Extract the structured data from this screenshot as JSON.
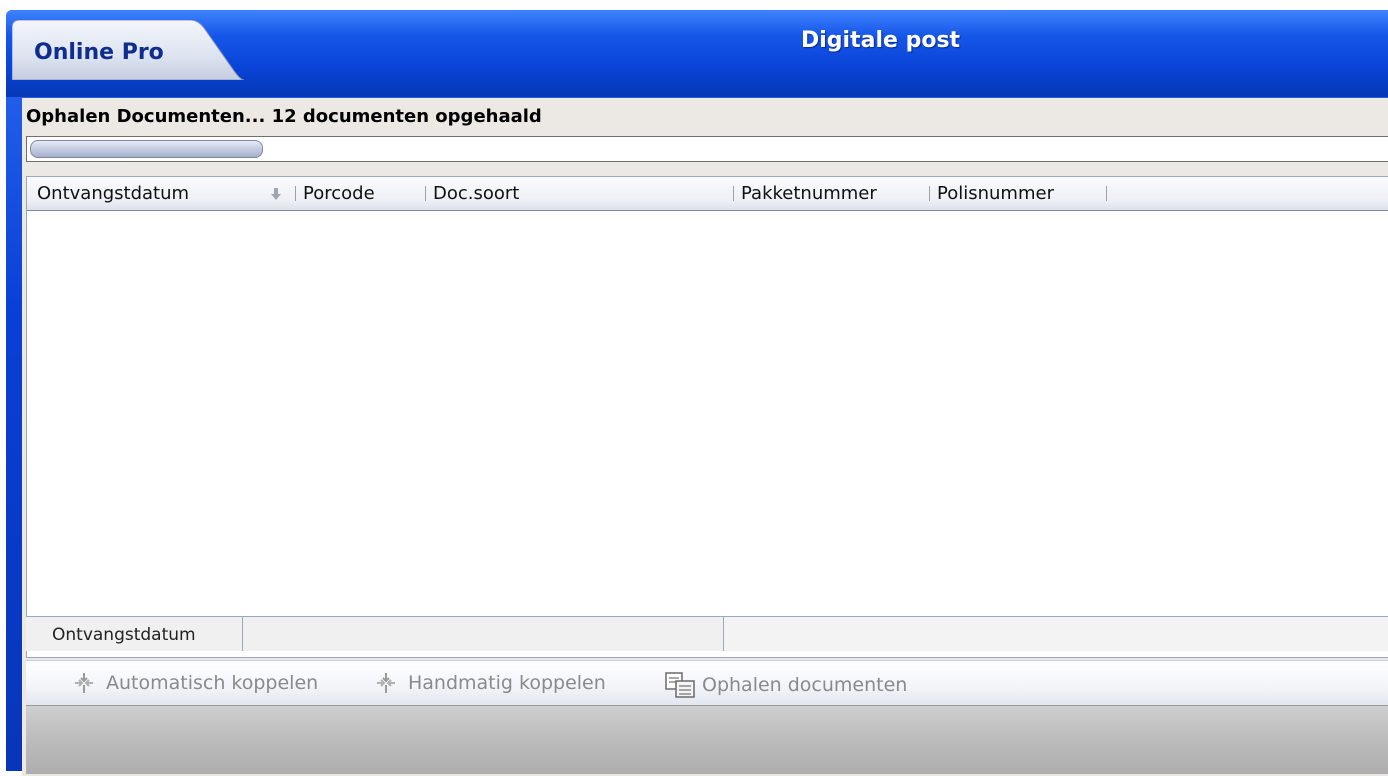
{
  "window": {
    "title": "Digitale post",
    "tab_label": "Online Pro"
  },
  "status": {
    "message": "Ophalen Documenten... 12 documenten opgehaald",
    "progress_fraction": 0.17
  },
  "grid": {
    "columns": [
      {
        "label": "Ontvangstdatum",
        "sorted": "descending"
      },
      {
        "label": "Porcode"
      },
      {
        "label": "Doc.soort"
      },
      {
        "label": "Pakketnummer"
      },
      {
        "label": "Polisnummer"
      }
    ],
    "rows": [],
    "footer": {
      "group_label": "Ontvangstdatum"
    }
  },
  "toolbar": {
    "auto_link_label": "Automatisch koppelen",
    "manual_link_label": "Handmatig koppelen",
    "fetch_docs_label": "Ophalen documenten"
  },
  "icons": {
    "sort": "arrow-down-icon",
    "auto_link": "link-arrows-icon",
    "manual_link": "link-arrows-icon",
    "fetch_docs": "documents-icon"
  },
  "colors": {
    "titlebar": "#0a44d8",
    "title_text": "#ffffff",
    "tab_text": "#0f2d8c",
    "disabled_text": "#8a8a8a"
  }
}
